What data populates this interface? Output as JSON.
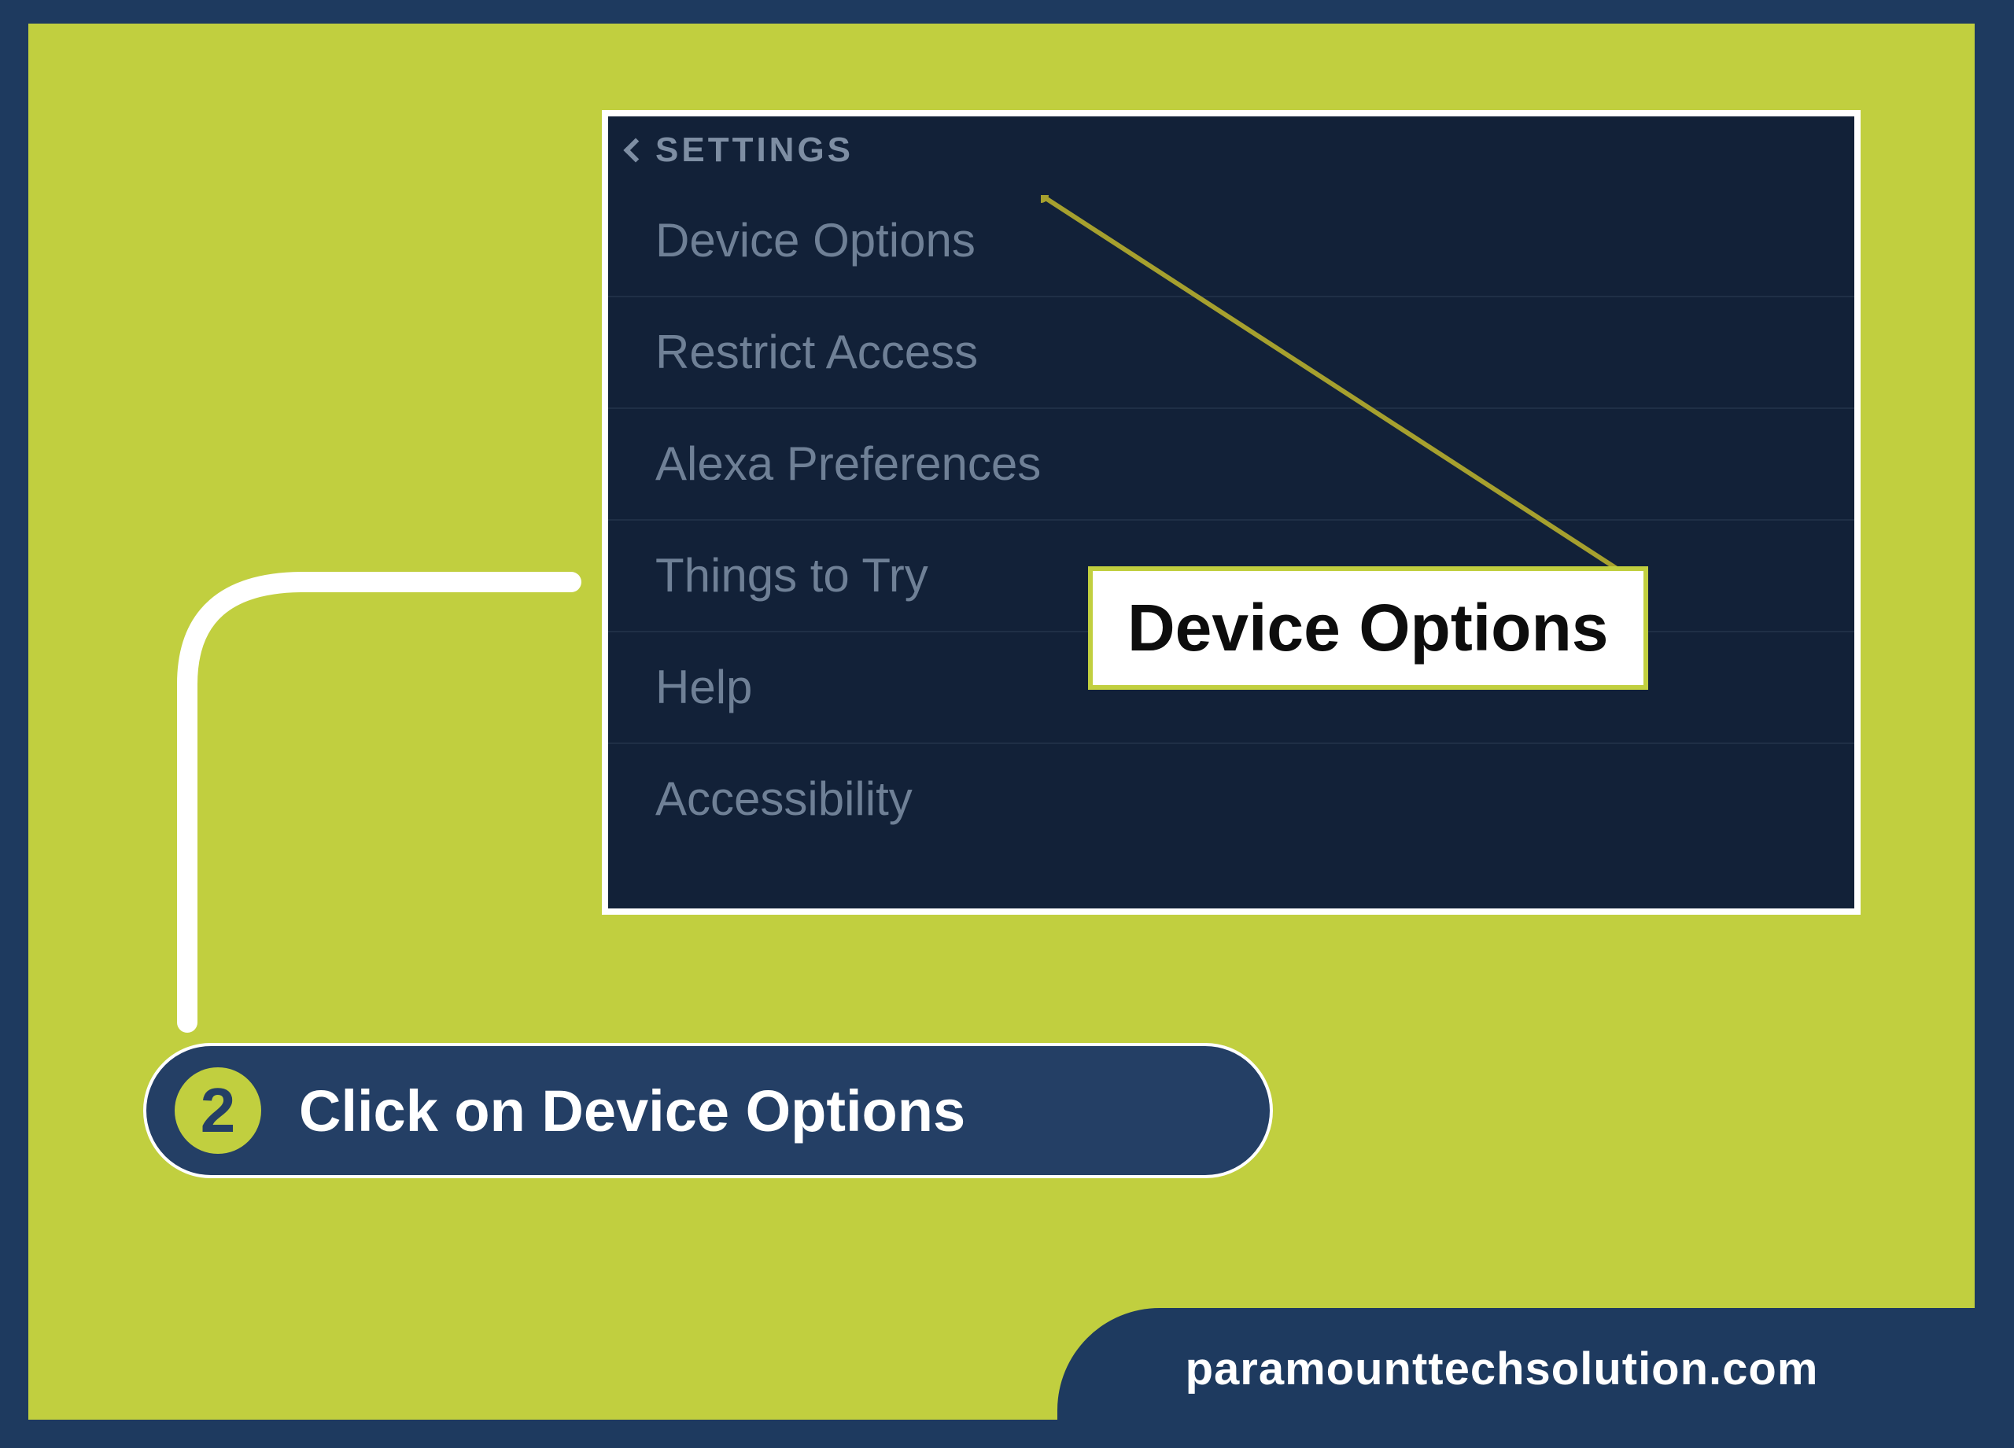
{
  "screenshot": {
    "back_label": "SETTINGS",
    "items": [
      "Device Options",
      "Restrict Access",
      "Alexa Preferences",
      "Things to Try",
      "Help",
      "Accessibility"
    ]
  },
  "callout": {
    "label": "Device Options"
  },
  "step": {
    "number": "2",
    "text": "Click on Device Options"
  },
  "brand": {
    "url": "paramounttechsolution.com"
  },
  "colors": {
    "bg_navy": "#1e3a5f",
    "bg_olive": "#c1cf3f",
    "panel_navy": "#122138",
    "pill_navy": "#243f65",
    "menu_text": "#6f8096",
    "white": "#ffffff",
    "black": "#0d0d0d",
    "leader_olive": "#a6a02e"
  }
}
